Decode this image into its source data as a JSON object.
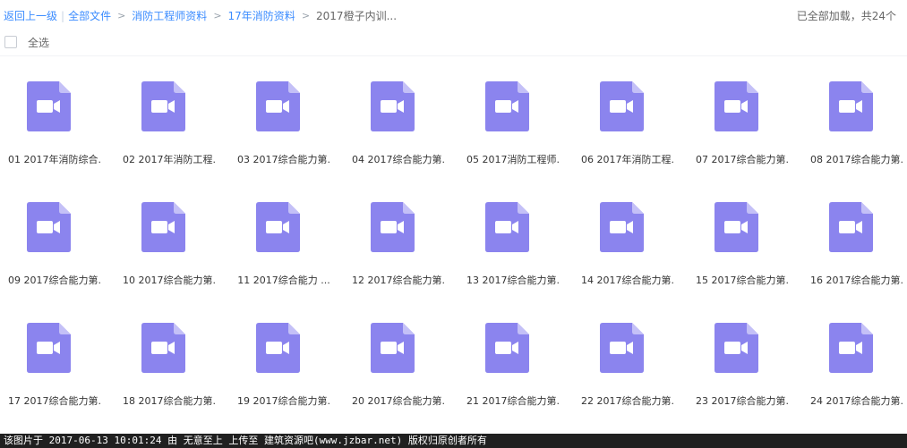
{
  "breadcrumb": {
    "back": "返回上一级",
    "items": [
      "全部文件",
      "消防工程师资料",
      "17年消防资料"
    ],
    "current": "2017橙子内训..."
  },
  "status": "已全部加载，共24个",
  "select_all": "全选",
  "icon_color": "#8b84ee",
  "files": [
    {
      "name": "01 2017年消防综合.",
      "icon": "video-icon"
    },
    {
      "name": "02 2017年消防工程.",
      "icon": "video-icon"
    },
    {
      "name": "03 2017综合能力第.",
      "icon": "video-icon"
    },
    {
      "name": "04 2017综合能力第.",
      "icon": "video-icon"
    },
    {
      "name": "05 2017消防工程师.",
      "icon": "video-icon"
    },
    {
      "name": "06 2017年消防工程.",
      "icon": "video-icon"
    },
    {
      "name": "07 2017综合能力第.",
      "icon": "video-icon"
    },
    {
      "name": "08 2017综合能力第.",
      "icon": "video-icon"
    },
    {
      "name": "09 2017综合能力第.",
      "icon": "video-icon"
    },
    {
      "name": "10 2017综合能力第.",
      "icon": "video-icon"
    },
    {
      "name": "11 2017综合能力 ...",
      "icon": "video-icon"
    },
    {
      "name": "12 2017综合能力第.",
      "icon": "video-icon"
    },
    {
      "name": "13 2017综合能力第.",
      "icon": "video-icon"
    },
    {
      "name": "14 2017综合能力第.",
      "icon": "video-icon"
    },
    {
      "name": "15 2017综合能力第.",
      "icon": "video-icon"
    },
    {
      "name": "16 2017综合能力第.",
      "icon": "video-icon"
    },
    {
      "name": "17 2017综合能力第.",
      "icon": "video-icon"
    },
    {
      "name": "18 2017综合能力第.",
      "icon": "video-icon"
    },
    {
      "name": "19 2017综合能力第.",
      "icon": "video-icon"
    },
    {
      "name": "20 2017综合能力第.",
      "icon": "video-icon"
    },
    {
      "name": "21 2017综合能力第.",
      "icon": "video-icon"
    },
    {
      "name": "22 2017综合能力第.",
      "icon": "video-icon"
    },
    {
      "name": "23 2017综合能力第.",
      "icon": "video-icon"
    },
    {
      "name": "24 2017综合能力第.",
      "icon": "video-icon"
    }
  ],
  "footer": "该图片于 2017-06-13 10:01:24 由 无意至上 上传至 建筑资源吧(www.jzbar.net) 版权归原创者所有"
}
